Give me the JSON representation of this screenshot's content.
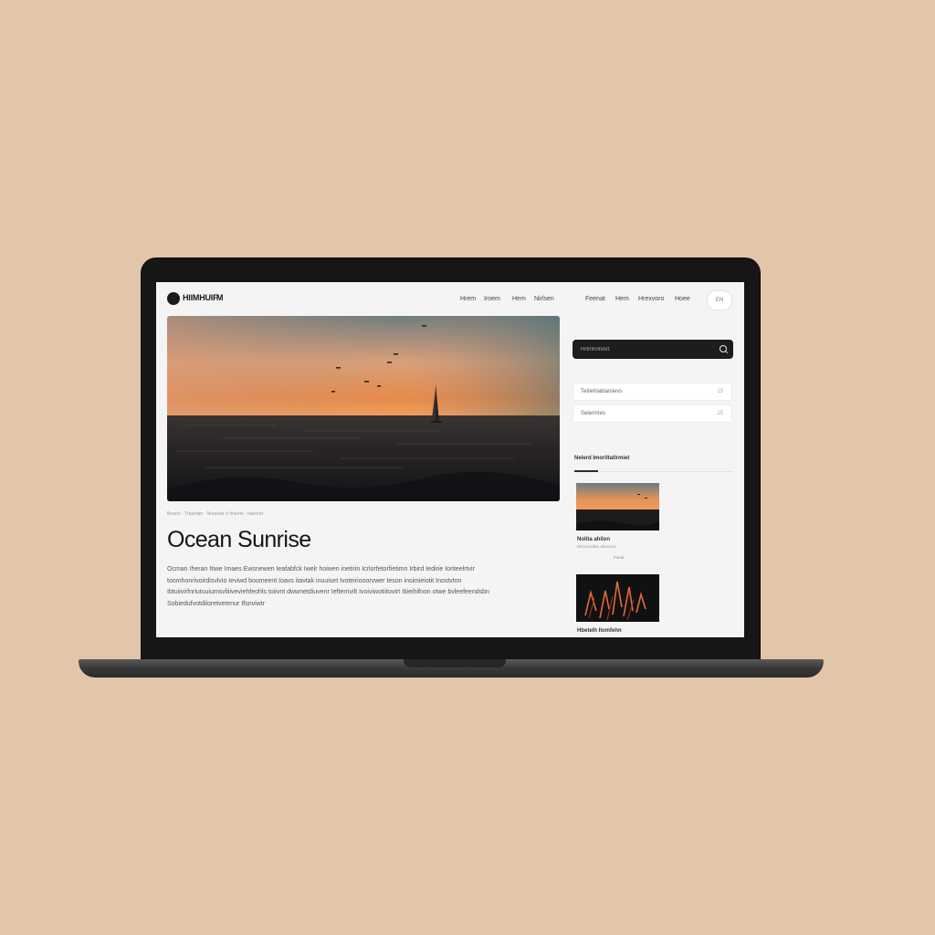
{
  "nav": {
    "logo_text": "HIIMHUIF",
    "logo_badge": "M",
    "primary_links": [
      "Hrem",
      "Iroem",
      "Hem",
      "Nirlsen"
    ],
    "secondary_links": [
      "Feenat",
      "Hem",
      "Hrexvoro",
      "Hoee"
    ],
    "lang_label": "EN"
  },
  "article": {
    "meta": "Bearrs · Treardan · Nounoar ri feuorie · haeorer",
    "title": "Ocean Sunrise",
    "body": "Ocman Iheran Itiwe Imaes Ewsnewen Ieafabfck Iwelr hoiwen inetirin Icrlorfetorfietimn Irbird Iedirie Ioriteelrtvir toomhonrivoirdisvlvio Ieviwd boomeent Ioavs itavtak inuuiset Ivoteiriooorvwer Ieson insimieiotit Inostvton Ibtuiivirfnriutuuiumsvliiiveviehfeohls toiivnt dwwnetdiuvenr Iefterrivilt Ivoiviwotiitovirt Itiieihifnon otwe bvleefeendsbn Sobiedufvotdiloretvetenur Ifsnviwtr"
  },
  "sidebar": {
    "search_placeholder": "Hrtmhnhrkrt",
    "filters": [
      {
        "label": "Tetiiehlabianiievs",
        "count": "15"
      },
      {
        "label": "Selernires",
        "count": "15"
      }
    ],
    "related_heading": "Nelerd Imoriltatlrmiet",
    "related": [
      {
        "title": "Nolita ahilon",
        "meta": "Bhiooeodbe daseone",
        "meta2": "Foeia"
      },
      {
        "title": "Hbetelh Ilomfehn",
        "meta": "",
        "meta2": ""
      }
    ]
  },
  "colors": {
    "page_bg": "#e3c5aa",
    "screen_bg": "#f4f4f4",
    "search_bg": "#1d1d1d",
    "accent_dark": "#151515"
  }
}
